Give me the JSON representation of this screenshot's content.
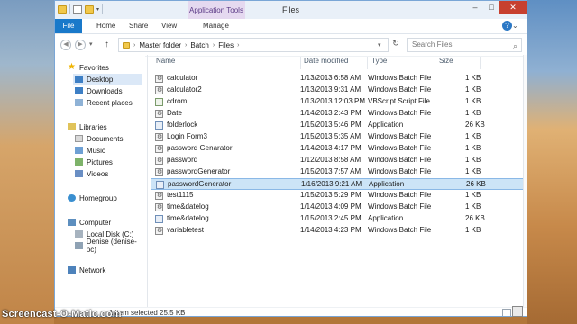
{
  "window": {
    "title": "Files",
    "contextual_tab": "Application Tools",
    "controls": [
      "–",
      "□",
      "✕"
    ]
  },
  "ribbon": {
    "tabs": [
      "File",
      "Home",
      "Share",
      "View",
      "Manage"
    ]
  },
  "address": {
    "breadcrumb": [
      "Master folder",
      "Batch",
      "Files"
    ],
    "search_placeholder": "Search Files"
  },
  "nav": {
    "favorites": "Favorites",
    "desktop": "Desktop",
    "downloads": "Downloads",
    "recent": "Recent places",
    "libraries": "Libraries",
    "documents": "Documents",
    "music": "Music",
    "pictures": "Pictures",
    "videos": "Videos",
    "homegroup": "Homegroup",
    "computer": "Computer",
    "local_disk": "Local Disk (C:)",
    "denise": "Denise (denise-pc)",
    "network": "Network"
  },
  "columns": {
    "name": "Name",
    "date": "Date modified",
    "type": "Type",
    "size": "Size"
  },
  "files": [
    {
      "name": "calculator",
      "date": "1/13/2013 6:58 AM",
      "type": "Windows Batch File",
      "size": "1 KB",
      "icon": "bat"
    },
    {
      "name": "calculator2",
      "date": "1/13/2013 9:31 AM",
      "type": "Windows Batch File",
      "size": "1 KB",
      "icon": "bat"
    },
    {
      "name": "cdrom",
      "date": "1/13/2013 12:03 PM",
      "type": "VBScript Script File",
      "size": "1 KB",
      "icon": "vbs"
    },
    {
      "name": "Date",
      "date": "1/14/2013 2:43 PM",
      "type": "Windows Batch File",
      "size": "1 KB",
      "icon": "bat"
    },
    {
      "name": "folderlock",
      "date": "1/15/2013 5:46 PM",
      "type": "Application",
      "size": "26 KB",
      "icon": "app"
    },
    {
      "name": "Login Form3",
      "date": "1/15/2013 5:35 AM",
      "type": "Windows Batch File",
      "size": "1 KB",
      "icon": "bat"
    },
    {
      "name": "password Genarator",
      "date": "1/14/2013 4:17 PM",
      "type": "Windows Batch File",
      "size": "1 KB",
      "icon": "bat"
    },
    {
      "name": "password",
      "date": "1/12/2013 8:58 AM",
      "type": "Windows Batch File",
      "size": "1 KB",
      "icon": "bat"
    },
    {
      "name": "passwordGenerator",
      "date": "1/15/2013 7:57 AM",
      "type": "Windows Batch File",
      "size": "1 KB",
      "icon": "bat"
    },
    {
      "name": "passwordGenerator",
      "date": "1/16/2013 9:21 AM",
      "type": "Application",
      "size": "26 KB",
      "icon": "app",
      "selected": true
    },
    {
      "name": "test1115",
      "date": "1/15/2013 5:29 PM",
      "type": "Windows Batch File",
      "size": "1 KB",
      "icon": "bat"
    },
    {
      "name": "time&datelog",
      "date": "1/14/2013 4:09 PM",
      "type": "Windows Batch File",
      "size": "1 KB",
      "icon": "bat"
    },
    {
      "name": "time&datelog",
      "date": "1/15/2013 2:45 PM",
      "type": "Application",
      "size": "26 KB",
      "icon": "app"
    },
    {
      "name": "variabletest",
      "date": "1/14/2013 4:23 PM",
      "type": "Windows Batch File",
      "size": "1 KB",
      "icon": "bat"
    }
  ],
  "status": {
    "text": "1 item selected  25.5 KB"
  },
  "watermark": "Screencast-O-Matic.com"
}
